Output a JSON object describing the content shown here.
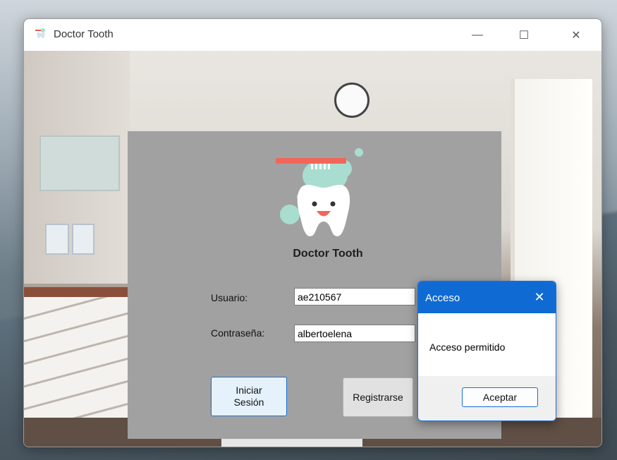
{
  "window": {
    "title": "Doctor Tooth",
    "controls": {
      "minimize": "—",
      "maximize": "☐",
      "close": "✕"
    }
  },
  "login": {
    "brand": "Doctor Tooth",
    "user_label": "Usuario:",
    "user_value": "ae210567",
    "password_label": "Contraseña:",
    "password_value": "albertoelena",
    "login_button": "Iniciar Sesión",
    "register_button": "Registrarse"
  },
  "dialog": {
    "title": "Acceso",
    "close": "✕",
    "message": "Acceso permitido",
    "accept_button": "Aceptar"
  },
  "colors": {
    "panel": "#a1a1a1",
    "dialog_title": "#0f6bd3",
    "tooth_accent": "#f2665a",
    "mint": "#a8ddd0"
  },
  "icons": {
    "app": "tooth-icon",
    "logo": "tooth-with-toothbrush-logo"
  }
}
